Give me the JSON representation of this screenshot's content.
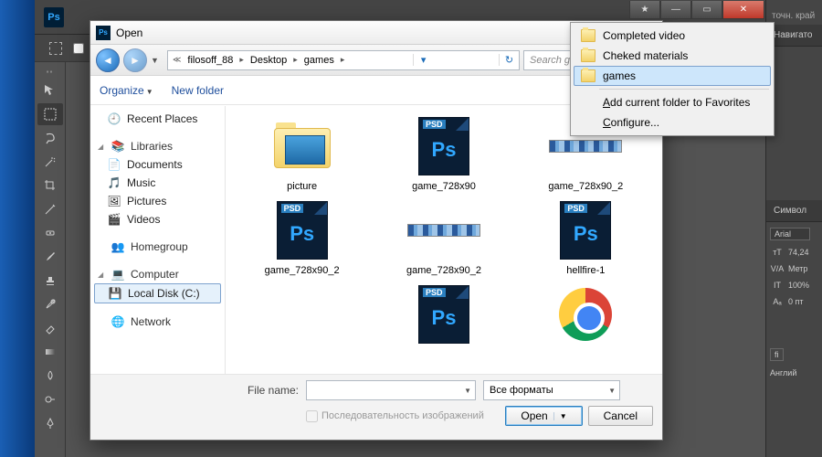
{
  "photoshop": {
    "logo": "Ps",
    "options": {
      "tip1": "точн.",
      "tip2": "край"
    },
    "right": {
      "tab_nav": "Навигато",
      "tab_symbol": "Символ",
      "font": "Arial",
      "size": "74,24",
      "metrics": "Метр",
      "leading": "100%",
      "baseline": "0 пт",
      "tab_lang": "Англий",
      "fi": "fi"
    }
  },
  "dialog": {
    "title": "Open",
    "nav": {
      "crumb1": "filosoff_88",
      "crumb2": "Desktop",
      "crumb3": "games",
      "search_placeholder": "Search games"
    },
    "toolbar": {
      "organize": "Organize",
      "newfolder": "New folder"
    },
    "sidebar": {
      "recent": "Recent Places",
      "libraries": "Libraries",
      "documents": "Documents",
      "music": "Music",
      "pictures": "Pictures",
      "videos": "Videos",
      "homegroup": "Homegroup",
      "computer": "Computer",
      "localdisk": "Local Disk (C:)",
      "network": "Network"
    },
    "files": [
      {
        "name": "picture",
        "type": "folder"
      },
      {
        "name": "game_728x90",
        "type": "psd"
      },
      {
        "name": "game_728x90_2",
        "type": "strip"
      },
      {
        "name": "game_728x90_2",
        "type": "psd"
      },
      {
        "name": "game_728x90_2",
        "type": "strip"
      },
      {
        "name": "hellfire-1",
        "type": "psd"
      },
      {
        "name": "",
        "type": "blank"
      },
      {
        "name": "",
        "type": "psd"
      },
      {
        "name": "",
        "type": "chrome"
      }
    ],
    "footer": {
      "filename_label": "File name:",
      "filename_value": "",
      "format": "Все форматы",
      "seq": "Последовательность изображений",
      "open": "Open",
      "cancel": "Cancel"
    }
  },
  "contextmenu": {
    "items": [
      {
        "label": "Completed video",
        "icon": true
      },
      {
        "label": "Cheked materials",
        "icon": true
      },
      {
        "label": "games",
        "icon": true,
        "hover": true
      }
    ],
    "add": "Add current folder to Favorites",
    "add_u": "A",
    "config": "Configure...",
    "config_u": "C"
  }
}
